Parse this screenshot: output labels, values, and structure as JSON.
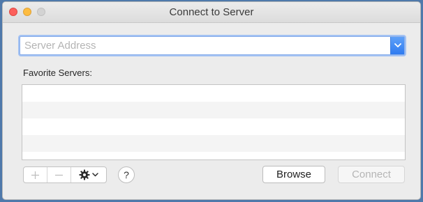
{
  "window": {
    "title": "Connect to Server"
  },
  "address": {
    "placeholder": "Server Address",
    "value": ""
  },
  "favorites": {
    "label": "Favorite Servers:",
    "rows": [
      "",
      "",
      "",
      ""
    ]
  },
  "toolbar": {
    "add_icon": "plus-icon",
    "remove_icon": "minus-icon",
    "action_icon": "gear-icon"
  },
  "help": {
    "label": "?"
  },
  "buttons": {
    "browse": "Browse",
    "connect": "Connect"
  },
  "colors": {
    "desktop": "#4f79ab",
    "accent": "#2f7bf0",
    "close": "#fc605c",
    "minimize": "#fdbc40",
    "disabled_text": "#b5b5b5"
  }
}
